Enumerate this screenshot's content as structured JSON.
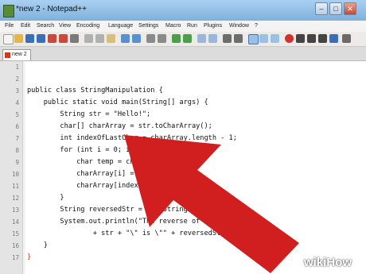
{
  "window": {
    "title": "*new  2 - Notepad++"
  },
  "menu": [
    "File",
    "Edit",
    "Search",
    "View",
    "Encoding",
    "Language",
    "Settings",
    "Macro",
    "Run",
    "Plugins",
    "Window",
    "?"
  ],
  "tab": {
    "label": "new  2"
  },
  "editor": {
    "lines": [
      {
        "num": "1",
        "text": ""
      },
      {
        "num": "2",
        "text": ""
      },
      {
        "num": "3",
        "text": "public class StringManipulation {"
      },
      {
        "num": "4",
        "text": "    public static void main(String[] args) {"
      },
      {
        "num": "5",
        "text": "        String str = \"Hello!\";"
      },
      {
        "num": "6",
        "text": "        char[] charArray = str.toCharArray();"
      },
      {
        "num": "7",
        "text": "        int indexOfLastChar = charArray.length - 1;"
      },
      {
        "num": "8",
        "text": "        for (int i = 0; i < charArr"
      },
      {
        "num": "9",
        "text": "            char temp = charArray[i];"
      },
      {
        "num": "10",
        "text": "            charArray[i] = charArray[in"
      },
      {
        "num": "11",
        "text": "            charArray[indexOfLastChar - "
      },
      {
        "num": "12",
        "text": "        }"
      },
      {
        "num": "13",
        "text": "        String reversedStr = new String(charA"
      },
      {
        "num": "14",
        "text": "        System.out.println(\"The reverse of the"
      },
      {
        "num": "15",
        "text": "                + str + \"\\\" is \\\"\" + reversedStr"
      },
      {
        "num": "16",
        "text": "    }"
      },
      {
        "num": "17",
        "text": "}"
      }
    ]
  },
  "watermark": {
    "wiki": "wiki",
    "how": "How"
  },
  "colors": {
    "arrow": "#d11f1f",
    "title_bar": "#a9d0f2",
    "closing_brace": "#d23c2a"
  }
}
